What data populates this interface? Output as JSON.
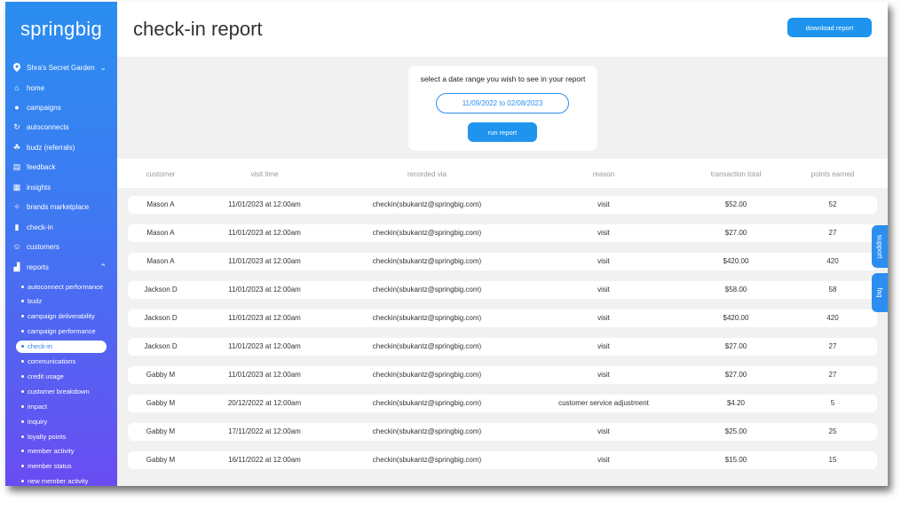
{
  "sidebar": {
    "logo": "springbig",
    "store": "Shra's Secret Garden",
    "items": [
      {
        "label": "home",
        "icon": "home-icon",
        "glyph": "⌂"
      },
      {
        "label": "campaigns",
        "icon": "chat-icon",
        "glyph": "●"
      },
      {
        "label": "autoconnects",
        "icon": "refresh-icon",
        "glyph": "↻"
      },
      {
        "label": "budz (referrals)",
        "icon": "referrals-icon",
        "glyph": "☘"
      },
      {
        "label": "feedback",
        "icon": "feedback-icon",
        "glyph": "▤"
      },
      {
        "label": "insights",
        "icon": "insights-icon",
        "glyph": "▦"
      },
      {
        "label": "brands marketplace",
        "icon": "handshake-icon",
        "glyph": "✧"
      },
      {
        "label": "check-in",
        "icon": "tablet-icon",
        "glyph": "▮"
      },
      {
        "label": "customers",
        "icon": "users-icon",
        "glyph": "☺"
      },
      {
        "label": "reports",
        "icon": "chart-icon",
        "glyph": "▟"
      }
    ],
    "report_items": [
      {
        "label": "autoconnect performance"
      },
      {
        "label": "budz"
      },
      {
        "label": "campaign deliverability"
      },
      {
        "label": "campaign performance"
      },
      {
        "label": "check-in"
      },
      {
        "label": "communications"
      },
      {
        "label": "credit usage"
      },
      {
        "label": "customer breakdown"
      },
      {
        "label": "impact"
      },
      {
        "label": "inquiry"
      },
      {
        "label": "loyalty points"
      },
      {
        "label": "member activity"
      },
      {
        "label": "member status"
      },
      {
        "label": "new member activity"
      }
    ],
    "active_report": "check-in"
  },
  "header": {
    "title": "check-in report",
    "download_label": "download report"
  },
  "date_range": {
    "prompt": "select a date range you wish to see in your report",
    "value": "11/09/2022 to 02/08/2023",
    "run_label": "run report"
  },
  "table": {
    "headers": [
      "customer",
      "visit time",
      "recorded via",
      "reason",
      "transaction total",
      "points earned"
    ],
    "rows": [
      [
        "Mason A",
        "11/01/2023 at 12:00am",
        "checkin(sbukantz@springbig.com)",
        "visit",
        "$52.00",
        "52"
      ],
      [
        "Mason A",
        "11/01/2023 at 12:00am",
        "checkin(sbukantz@springbig.com)",
        "visit",
        "$27.00",
        "27"
      ],
      [
        "Mason A",
        "11/01/2023 at 12:00am",
        "checkin(sbukantz@springbig.com)",
        "visit",
        "$420.00",
        "420"
      ],
      [
        "Jackson D",
        "11/01/2023 at 12:00am",
        "checkin(sbukantz@springbig.com)",
        "visit",
        "$58.00",
        "58"
      ],
      [
        "Jackson D",
        "11/01/2023 at 12:00am",
        "checkin(sbukantz@springbig.com)",
        "visit",
        "$420.00",
        "420"
      ],
      [
        "Jackson D",
        "11/01/2023 at 12:00am",
        "checkin(sbukantz@springbig.com)",
        "visit",
        "$27.00",
        "27"
      ],
      [
        "Gabby M",
        "11/01/2023 at 12:00am",
        "checkin(sbukantz@springbig.com)",
        "visit",
        "$27.00",
        "27"
      ],
      [
        "Gabby M",
        "20/12/2022 at 12:00am",
        "checkin(sbukantz@springbig.com)",
        "customer service adjustment",
        "$4.20",
        "5"
      ],
      [
        "Gabby M",
        "17/11/2022 at 12:00am",
        "checkin(sbukantz@springbig.com)",
        "visit",
        "$25.00",
        "25"
      ],
      [
        "Gabby M",
        "16/11/2022 at 12:00am",
        "checkin(sbukantz@springbig.com)",
        "visit",
        "$15.00",
        "15"
      ]
    ]
  },
  "side_tabs": {
    "support": "support",
    "faq": "faq"
  },
  "colors": {
    "accent": "#1e94ee",
    "sidebar_top": "#2a8ef0",
    "sidebar_bottom": "#6a4cf2"
  }
}
